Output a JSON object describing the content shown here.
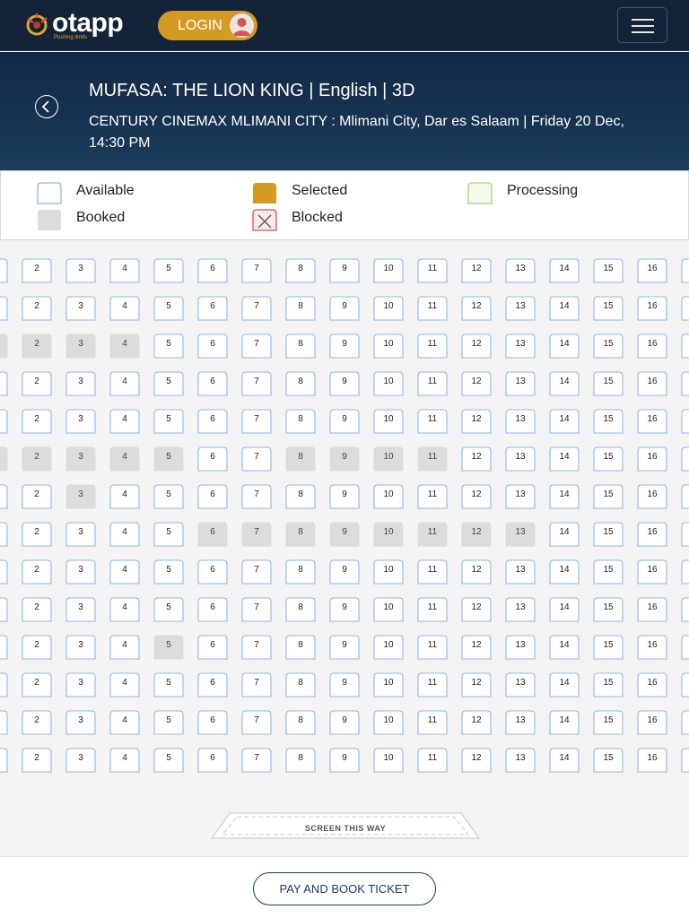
{
  "navbar": {
    "brand": "otapp",
    "tagline": "Pushing limits",
    "login_label": "LOGIN"
  },
  "movie": {
    "title": "MUFASA: THE LION KING | English | 3D",
    "details": "CENTURY CINEMAX MLIMANI CITY : Mlimani City, Dar es Salaam | Friday 20 Dec, 14:30 PM"
  },
  "legend": {
    "available": "Available",
    "selected": "Selected",
    "processing": "Processing",
    "booked": "Booked",
    "blocked": "Blocked"
  },
  "colors": {
    "available_border": "#8fb8e8",
    "selected": "#d49a24",
    "processing_border": "#9dd86a",
    "booked": "#dcdcdc",
    "blocked_border": "#d9534f",
    "navy": "#132338"
  },
  "seat_numbers": [
    "2",
    "3",
    "4",
    "5",
    "6",
    "7",
    "8",
    "9",
    "10",
    "11",
    "12",
    "13",
    "14",
    "15",
    "16"
  ],
  "rows": [
    {
      "booked": []
    },
    {
      "booked": []
    },
    {
      "booked": [
        "1",
        "2",
        "3",
        "4"
      ]
    },
    {
      "booked": []
    },
    {
      "booked": []
    },
    {
      "booked": [
        "1",
        "2",
        "3",
        "4",
        "5",
        "8",
        "9",
        "10",
        "11"
      ]
    },
    {
      "booked": [
        "3"
      ]
    },
    {
      "booked": [
        "6",
        "7",
        "8",
        "9",
        "10",
        "11",
        "12",
        "13"
      ]
    },
    {
      "booked": []
    },
    {
      "booked": []
    },
    {
      "booked": [
        "5"
      ]
    },
    {
      "booked": []
    },
    {
      "booked": []
    },
    {
      "booked": []
    }
  ],
  "screen_label": "SCREEN THIS WAY",
  "pay_button": "PAY AND BOOK TICKET"
}
